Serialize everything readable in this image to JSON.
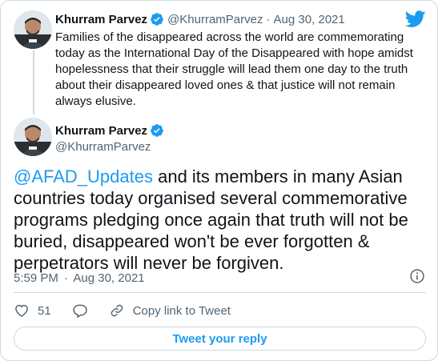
{
  "parent_tweet": {
    "author_name": "Khurram Parvez",
    "handle": "@KhurramParvez",
    "separator": "·",
    "date": "Aug 30, 2021",
    "text": "Families of the disappeared across the world are commemorating today as the International Day of the Disappeared with hope amidst hopelessness that their struggle will lead them one day to the truth about their disappeared loved ones & that justice will not remain always elusive."
  },
  "main_tweet": {
    "author_name": "Khurram Parvez",
    "handle": "@KhurramParvez",
    "mention": "@AFAD_Updates",
    "text": " and its members in many Asian countries today organised several commemorative programs pledging once again that truth will not be buried, disappeared won't be ever forgotten & perpetrators will never be forgiven.",
    "time": "5:59 PM",
    "separator": "·",
    "date": "Aug 30, 2021"
  },
  "actions": {
    "like_count": "51",
    "copy_link_label": "Copy link to Tweet"
  },
  "reply_button_label": "Tweet your reply",
  "icons": {
    "brand": "twitter-bird-icon",
    "verified": "verified-badge-icon",
    "info": "info-icon",
    "like": "heart-icon",
    "reply": "reply-bubble-icon",
    "copy": "link-icon"
  },
  "colors": {
    "accent": "#1d9bf0",
    "text": "#0f1419",
    "muted": "#536471",
    "border": "#cfd9de"
  }
}
